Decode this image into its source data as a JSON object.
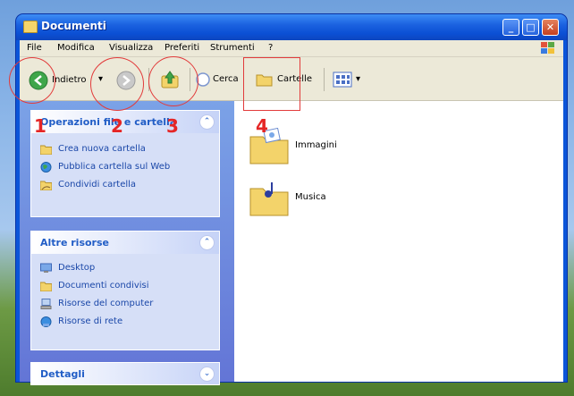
{
  "window": {
    "title": "Documenti"
  },
  "titlebar_buttons": {
    "minimize": "_",
    "maximize": "□",
    "close": "✕"
  },
  "menu": [
    "File",
    "Modifica",
    "Visualizza",
    "Preferiti",
    "Strumenti",
    "?"
  ],
  "toolbar": {
    "back": "Indietro",
    "search": "Cerca",
    "folders": "Cartelle",
    "dropdown": "▾"
  },
  "annotations": [
    "1",
    "2",
    "3",
    "4"
  ],
  "panels": {
    "operations": {
      "title": "Operazioni file e cartella",
      "toggle": "⌃",
      "items": [
        "Crea nuova cartella",
        "Pubblica cartella sul Web",
        "Condividi cartella"
      ]
    },
    "other": {
      "title": "Altre risorse",
      "toggle": "⌃",
      "items": [
        "Desktop",
        "Documenti condivisi",
        "Risorse del computer",
        "Risorse di rete"
      ]
    },
    "details": {
      "title": "Dettagli",
      "toggle": "⌄"
    }
  },
  "folders": [
    "Immagini",
    "Musica"
  ],
  "colors": {
    "accent": "#215dc6",
    "annotation": "#e23b3b",
    "titlebar": "#0b4fd4"
  }
}
